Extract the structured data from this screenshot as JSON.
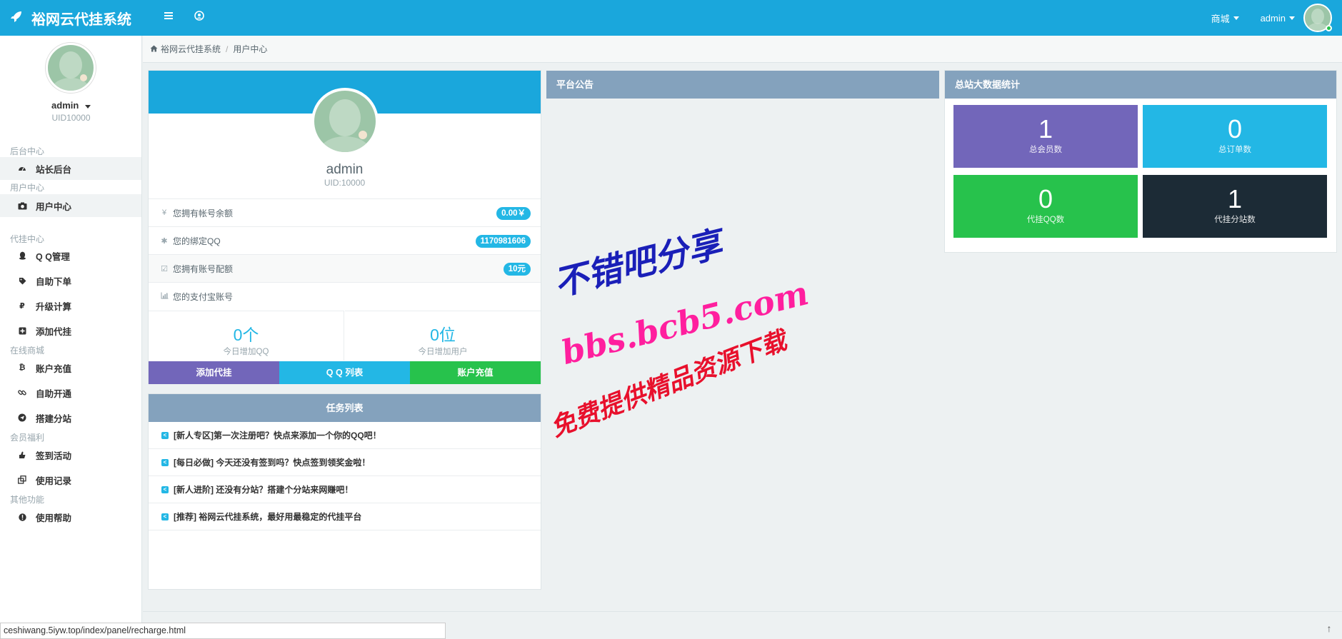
{
  "header": {
    "brand": "裕网云代挂系统",
    "mall_label": "商城",
    "user_label": "admin"
  },
  "sidebar": {
    "username": "admin",
    "uid": "UID10000",
    "groups": [
      {
        "title": "后台中心",
        "items": [
          {
            "label": "站长后台",
            "icon": "dashboard-icon"
          }
        ]
      },
      {
        "title": "用户中心",
        "items": [
          {
            "label": "用户中心",
            "icon": "camera-icon"
          }
        ]
      },
      {
        "title": "代挂中心",
        "items": [
          {
            "label": "Q Q管理",
            "icon": "qq-icon"
          },
          {
            "label": "自助下单",
            "icon": "tag-icon"
          },
          {
            "label": "升级计算",
            "icon": "rouble-icon"
          },
          {
            "label": "添加代挂",
            "icon": "plus-square-icon"
          }
        ]
      },
      {
        "title": "在线商城",
        "items": [
          {
            "label": "账户充值",
            "icon": "bitcoin-icon"
          },
          {
            "label": "自助开通",
            "icon": "link-icon"
          },
          {
            "label": "搭建分站",
            "icon": "send-icon"
          }
        ]
      },
      {
        "title": "会员福利",
        "items": [
          {
            "label": "签到活动",
            "icon": "hand-icon"
          },
          {
            "label": "使用记录",
            "icon": "clone-icon"
          }
        ]
      },
      {
        "title": "其他功能",
        "items": [
          {
            "label": "使用帮助",
            "icon": "info-icon"
          }
        ]
      }
    ]
  },
  "breadcrumb": {
    "home": "裕网云代挂系统",
    "current": "用户中心"
  },
  "profile": {
    "name": "admin",
    "uid": "UID:10000",
    "rows": [
      {
        "label": "您拥有帐号余额",
        "value": "0.00￥",
        "icon": "yen-icon"
      },
      {
        "label": "您的绑定QQ",
        "value": "1170981606",
        "icon": "asterisk-icon"
      },
      {
        "label": "您拥有账号配额",
        "value": "10元",
        "icon": "check-square-icon"
      },
      {
        "label": "您的支付宝账号",
        "value": "",
        "icon": "bar-chart-icon"
      }
    ],
    "today_qq_value": "0个",
    "today_qq_label": "今日增加QQ",
    "today_user_value": "0位",
    "today_user_label": "今日增加用户",
    "buttons": {
      "add": "添加代挂",
      "qq_list": "Q Q 列表",
      "recharge": "账户充值"
    },
    "colors": {
      "add": "#7266ba",
      "qq_list": "#23b7e5",
      "recharge": "#27c24c"
    }
  },
  "tasks": {
    "title": "任务列表",
    "items": [
      "[新人专区]第一次注册吧？快点来添加一个你的QQ吧！",
      "[每日必做] 今天还没有签到吗？快点签到领奖金啦！",
      "[新人进阶] 还没有分站？搭建个分站来网赚吧！",
      "[推荐] 裕网云代挂系统，最好用最稳定的代挂平台"
    ]
  },
  "announcement": {
    "title": "平台公告"
  },
  "stats": {
    "title": "总站大数据统计",
    "tiles": [
      {
        "value": "1",
        "label": "总会员数",
        "color": "#7266ba"
      },
      {
        "value": "0",
        "label": "总订单数",
        "color": "#23b7e5"
      },
      {
        "value": "0",
        "label": "代挂QQ数",
        "color": "#27c24c"
      },
      {
        "value": "1",
        "label": "代挂分站数",
        "color": "#1c2b36"
      }
    ]
  },
  "watermark": {
    "line1": "不错吧分享",
    "line2": "bbs.bcb5.com",
    "line3": "免费提供精品资源下载"
  },
  "statusbar": {
    "url": "ceshiwang.5iyw.top/index/panel/recharge.html"
  }
}
